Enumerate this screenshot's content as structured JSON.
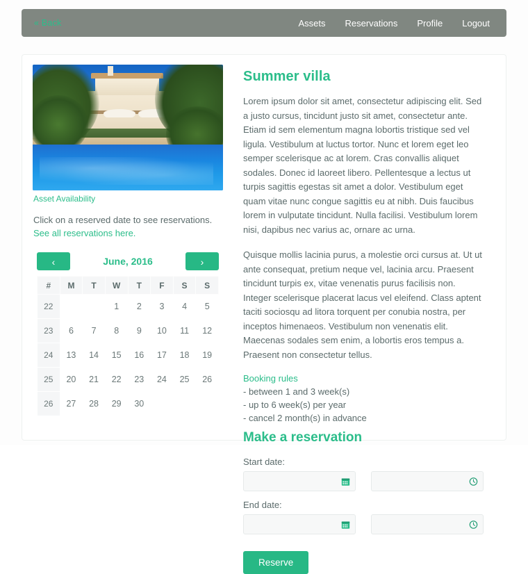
{
  "nav": {
    "back_label": "« Back",
    "links": [
      {
        "label": "Assets"
      },
      {
        "label": "Reservations"
      },
      {
        "label": "Profile"
      },
      {
        "label": "Logout"
      }
    ]
  },
  "asset": {
    "photo_alt": "villa-with-pool-photo",
    "availability_label": "Asset Availability",
    "hint_text": "Click on a reserved date to see reservations. ",
    "hint_link": "See all reservations here."
  },
  "calendar": {
    "prev_label": "‹",
    "next_label": "›",
    "month_title": "June, 2016",
    "day_headers": [
      "#",
      "M",
      "T",
      "W",
      "T",
      "F",
      "S",
      "S"
    ],
    "weeks": [
      {
        "week": "22",
        "days": [
          {
            "label": "",
            "state": "pad"
          },
          {
            "label": "",
            "state": "pad"
          },
          {
            "label": "1",
            "state": "dim"
          },
          {
            "label": "2",
            "state": "dim"
          },
          {
            "label": "3",
            "state": "dim"
          },
          {
            "label": "4",
            "state": "dim"
          },
          {
            "label": "5",
            "state": "dim"
          }
        ]
      },
      {
        "week": "23",
        "days": [
          {
            "label": "6",
            "state": "dim"
          },
          {
            "label": "7",
            "state": "dim"
          },
          {
            "label": "8",
            "state": "dim"
          },
          {
            "label": "9",
            "state": "dim"
          },
          {
            "label": "10",
            "state": "dim"
          },
          {
            "label": "11",
            "state": "res"
          },
          {
            "label": "12",
            "state": "res"
          }
        ]
      },
      {
        "week": "24",
        "days": [
          {
            "label": "13",
            "state": "res"
          },
          {
            "label": "14",
            "state": "res"
          },
          {
            "label": "15",
            "state": "res"
          },
          {
            "label": "16",
            "state": "res"
          },
          {
            "label": "17",
            "state": "res"
          },
          {
            "label": "18",
            "state": "res"
          },
          {
            "label": "19",
            "state": "dim"
          }
        ]
      },
      {
        "week": "25",
        "days": [
          {
            "label": "20",
            "state": "pend"
          },
          {
            "label": "21",
            "state": "free"
          },
          {
            "label": "22",
            "state": "res"
          },
          {
            "label": "23",
            "state": "res"
          },
          {
            "label": "24",
            "state": "res"
          },
          {
            "label": "25",
            "state": "res"
          },
          {
            "label": "26",
            "state": "free"
          }
        ]
      },
      {
        "week": "26",
        "days": [
          {
            "label": "27",
            "state": "free"
          },
          {
            "label": "28",
            "state": "free"
          },
          {
            "label": "29",
            "state": "free"
          },
          {
            "label": "30",
            "state": "free"
          },
          {
            "label": "",
            "state": "empty"
          },
          {
            "label": "",
            "state": "empty"
          },
          {
            "label": "",
            "state": "empty"
          }
        ]
      }
    ]
  },
  "detail": {
    "title": "Summer villa",
    "paragraphs": [
      "Lorem ipsum dolor sit amet, consectetur adipiscing elit. Sed a justo cursus, tincidunt justo sit amet, consectetur ante. Etiam id sem elementum magna lobortis tristique sed vel ligula. Vestibulum at luctus tortor. Nunc et lorem eget leo semper scelerisque ac at lorem. Cras convallis aliquet sodales. Donec id laoreet libero. Pellentesque a lectus ut turpis sagittis egestas sit amet a dolor. Vestibulum eget quam vitae nunc congue sagittis eu at nibh. Duis faucibus lorem in vulputate tincidunt. Nulla facilisi. Vestibulum lorem nisi, dapibus nec varius ac, ornare ac urna.",
      "Quisque mollis lacinia purus, a molestie orci cursus at. Ut ut ante consequat, pretium neque vel, lacinia arcu. Praesent tincidunt turpis ex, vitae venenatis purus facilisis non. Integer scelerisque placerat lacus vel eleifend. Class aptent taciti sociosqu ad litora torquent per conubia nostra, per inceptos himenaeos. Vestibulum non venenatis elit. Maecenas sodales sem enim, a lobortis eros tempus a. Praesent non consectetur tellus."
    ],
    "rules_title": "Booking rules",
    "rules": [
      "- between 1 and 3 week(s)",
      "- up to 6 week(s) per year",
      "- cancel 2 month(s) in advance"
    ]
  },
  "reservation": {
    "heading": "Make a reservation",
    "start_label": "Start date:",
    "end_label": "End date:",
    "start_date_value": "",
    "start_time_value": "",
    "end_date_value": "",
    "end_time_value": "",
    "submit_label": "Reserve"
  },
  "colors": {
    "accent_green": "#2bbd8a",
    "button_green": "#27b885",
    "navbar_gray": "#808781",
    "reserved_red": "#dd1111",
    "pending_orange": "#fcd9a0",
    "text_gray": "#5b6b6b"
  }
}
